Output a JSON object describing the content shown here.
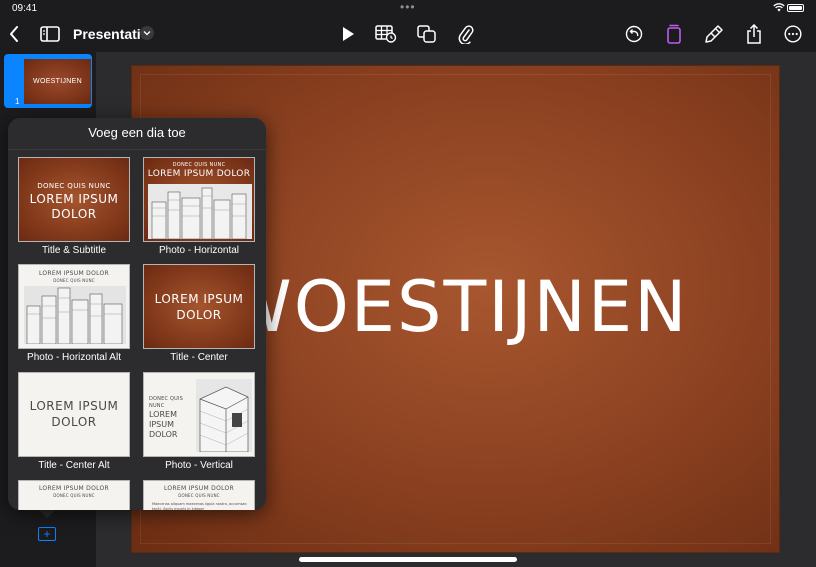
{
  "status": {
    "time": "09:41",
    "dots": "•••"
  },
  "toolbar": {
    "doc_title": "Presentatie"
  },
  "navigator": {
    "slide_number": "1",
    "slide_thumb_title": "WOESTIJNEN"
  },
  "slide": {
    "title": "WOESTIJNEN"
  },
  "popover": {
    "title": "Voeg een dia toe",
    "layouts": [
      {
        "label": "Title & Subtitle",
        "l1": "DONEC QUIS NUNC",
        "l2": "LOREM IPSUM",
        "l3": "DOLOR"
      },
      {
        "label": "Photo - Horizontal",
        "l1": "DONEC QUIS NUNC",
        "l2": "LOREM IPSUM DOLOR"
      },
      {
        "label": "Photo - Horizontal Alt",
        "l1": "LOREM IPSUM DOLOR",
        "l2": "DONEC QUIS NUNC"
      },
      {
        "label": "Title - Center",
        "l1": "LOREM IPSUM",
        "l2": "DOLOR"
      },
      {
        "label": "Title - Center Alt",
        "l1": "LOREM IPSUM",
        "l2": "DOLOR"
      },
      {
        "label": "Photo - Vertical",
        "l1": "DONEC QUIS NUNC",
        "l2": "LOREM",
        "l3": "IPSUM",
        "l4": "DOLOR"
      },
      {
        "l1": "LOREM IPSUM DOLOR",
        "l2": "DONEC QUIS NUNC"
      },
      {
        "l1": "LOREM IPSUM DOLOR",
        "l2": "DONEC QUIS NUNC",
        "l3": "Maecenas aliquam maecenas ligula nostra, accumsan taciti. Sociis mauris in integer"
      }
    ]
  },
  "colors": {
    "accent": "#0a84ff",
    "active_icon": "#bf5af2",
    "slide_brown": "#8a4020"
  },
  "icons": [
    "back-chevron-icon",
    "sidebar-icon",
    "play-icon",
    "table-icon",
    "shapes-icon",
    "paperclip-icon",
    "undo-icon",
    "format-icon",
    "brush-icon",
    "share-icon",
    "more-icon",
    "add-slide-icon"
  ]
}
